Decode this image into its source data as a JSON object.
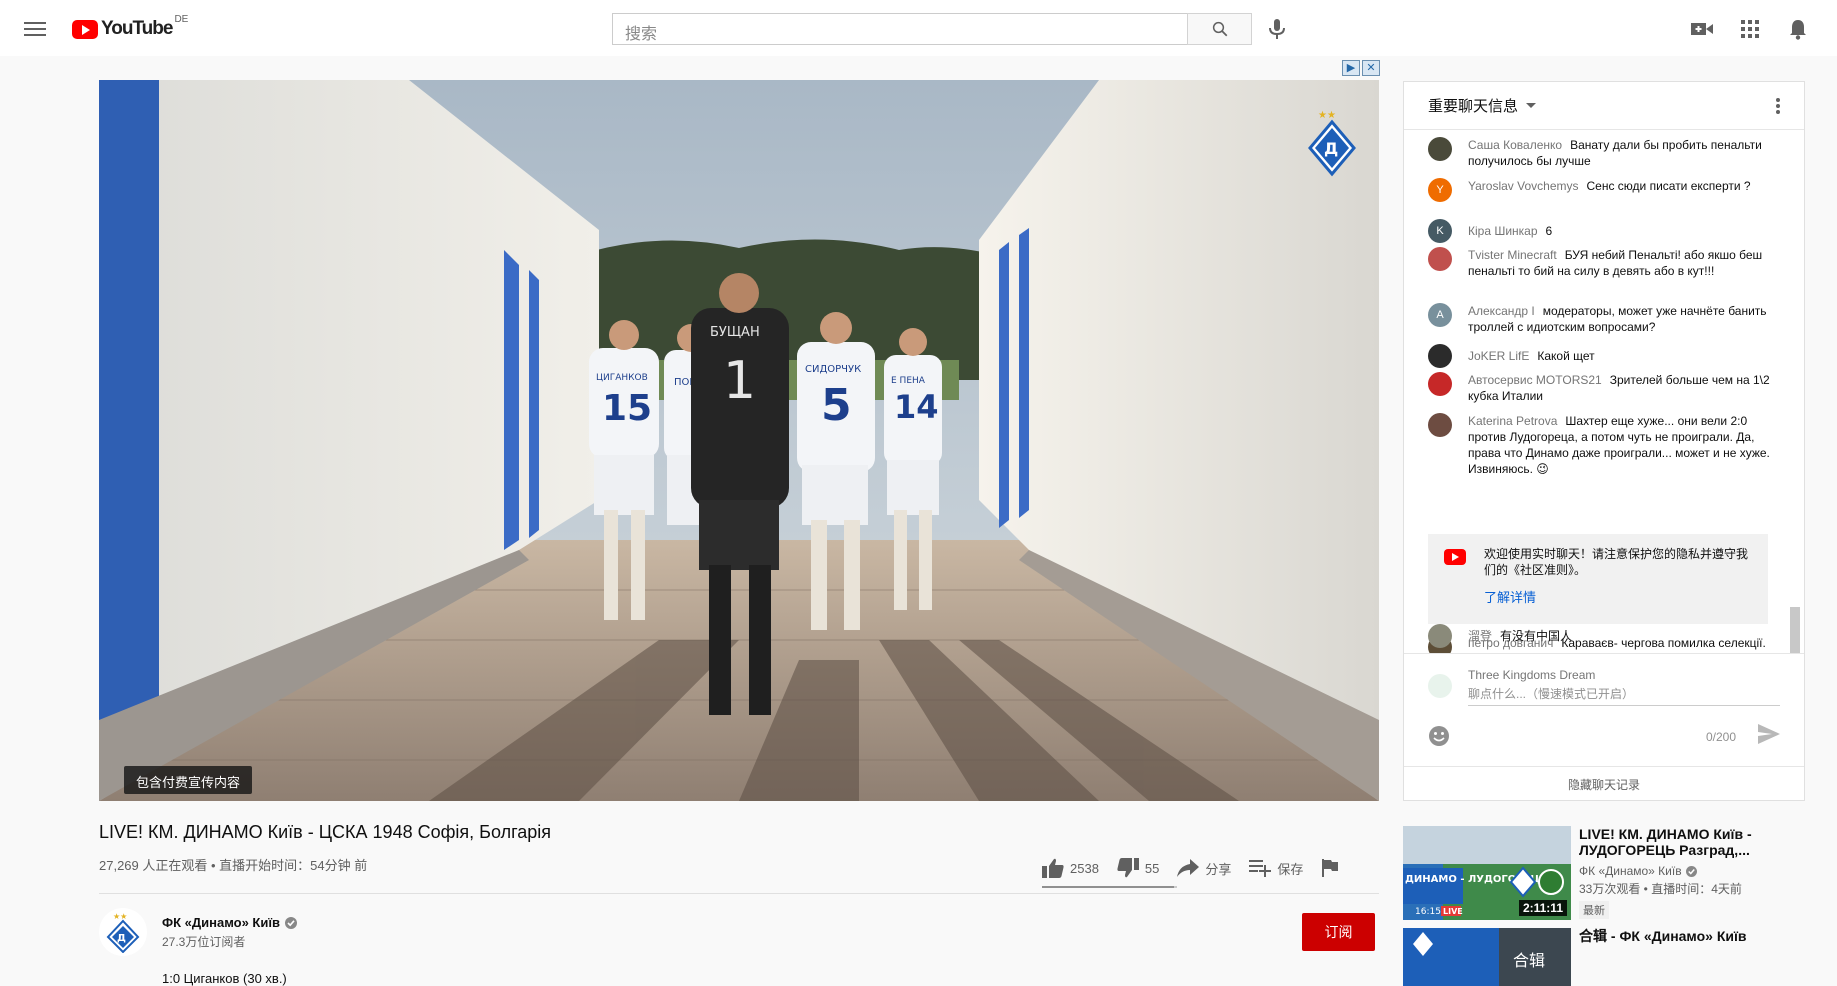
{
  "header": {
    "logo_text": "YouTube",
    "region": "DE",
    "search_placeholder": "搜索",
    "icons": [
      "menu-icon",
      "search-icon",
      "mic-icon",
      "create-video-icon",
      "apps-grid-icon",
      "notifications-bell-icon"
    ]
  },
  "player": {
    "ad_badge": [
      "▶",
      "✕"
    ],
    "paid_label": "包含付费宣传内容",
    "jersey_numbers": [
      "15",
      "1",
      "5",
      "14"
    ],
    "jersey_names": [
      "ЦИГАНКОВ",
      "ПОП",
      "БУЩАН",
      "СИДОРЧУК",
      "Е ПЕНА"
    ]
  },
  "video": {
    "title": "LIVE! КМ. ДИНАМО Київ - ЦСКА 1948 Софія, Болгарія",
    "meta": "27,269 人正在观看 • 直播开始时间：54分钟 前",
    "likes": "2538",
    "dislikes": "55",
    "like_ratio": 0.979,
    "share_label": "分享",
    "save_label": "保存"
  },
  "channel": {
    "name": "ФК «Динамо» Київ",
    "subscribers": "27.3万位订阅者",
    "subscribe_label": "订阅",
    "description_line": "1:0 Циганков (30 хв.)"
  },
  "chat": {
    "header_title": "重要聊天信息",
    "messages": [
      {
        "author": "Саша Коваленко",
        "text": "Ванату дали бы пробить пенальти получилось бы лучше",
        "avatar_letter": "",
        "avatar_color": "#4a4a3a"
      },
      {
        "author": "Yaroslav Vovchemys",
        "text": "Сенс сюди писати експерти ?",
        "avatar_letter": "Y",
        "avatar_color": "#ef6c00"
      },
      {
        "author": "Кіра Шинкар",
        "text": "6",
        "avatar_letter": "K",
        "avatar_color": "#455a64"
      },
      {
        "author": "Tvister Minecraft",
        "text": "БУЯ небий Пенальті! або якшо беш пенальті то бий на силу в девять або в кут!!!",
        "avatar_letter": "",
        "avatar_color": "#c0504d"
      },
      {
        "author": "Александр I",
        "text": "модераторы, может уже начнёте банить троллей с идиотским вопросами?",
        "avatar_letter": "A",
        "avatar_color": "#78909c"
      },
      {
        "author": "JoKER LifE",
        "text": "Какой щет",
        "avatar_letter": "",
        "avatar_color": "#2b2b2b"
      },
      {
        "author": "Автосервис MOTORS21",
        "text": "Зрителей больше чем на 1\\2 кубка Италии",
        "avatar_letter": "",
        "avatar_color": "#c62828"
      },
      {
        "author": "Katerina Petrova",
        "text": "Шахтер еще хуже... они вели 2:0 против Лудогореца, а потом чуть не проиграли. Да, права что Динамо даже проиграли... может и не хуже. Извиняюсь. 😉",
        "avatar_letter": "",
        "avatar_color": "#6d4c41"
      },
      {
        "author": "петро довганич",
        "text": "Караваєв- чергова помилка селекції. Ужас!!!",
        "avatar_letter": "",
        "avatar_color": "#5d4e37"
      },
      {
        "author": "溜登",
        "text": "有没有中国人",
        "avatar_letter": "",
        "avatar_color": "#8a8a7a"
      }
    ],
    "notice_text": "欢迎使用实时聊天！请注意保护您的隐私并遵守我们的《社区准则》。",
    "notice_link": "了解详情",
    "composer_name": "Three Kingdoms Dream",
    "composer_placeholder": "聊点什么...（慢速模式已开启）",
    "char_count": "0/200",
    "hide_chat": "隐藏聊天记录"
  },
  "related": [
    {
      "title": "LIVE! КМ. ДИНАМО Київ - ЛУДОГОРЕЦЬ Разград,...",
      "channel": "ФК «Динамо» Київ",
      "stats": "33万次观看 • 直播时间：4天前",
      "badge": "最新",
      "duration": "2:11:11",
      "thumb_text": "ДИНАМО - ЛУДОГОРЕЦЬ",
      "thumb_time": "16:15",
      "thumb_live": "LIVE"
    },
    {
      "title": "合辑 - ФК «Динамо» Київ",
      "channel": "",
      "stats": "",
      "badge": "",
      "duration": "",
      "thumb_text": "合辑",
      "thumb_time": "",
      "thumb_live": ""
    }
  ]
}
